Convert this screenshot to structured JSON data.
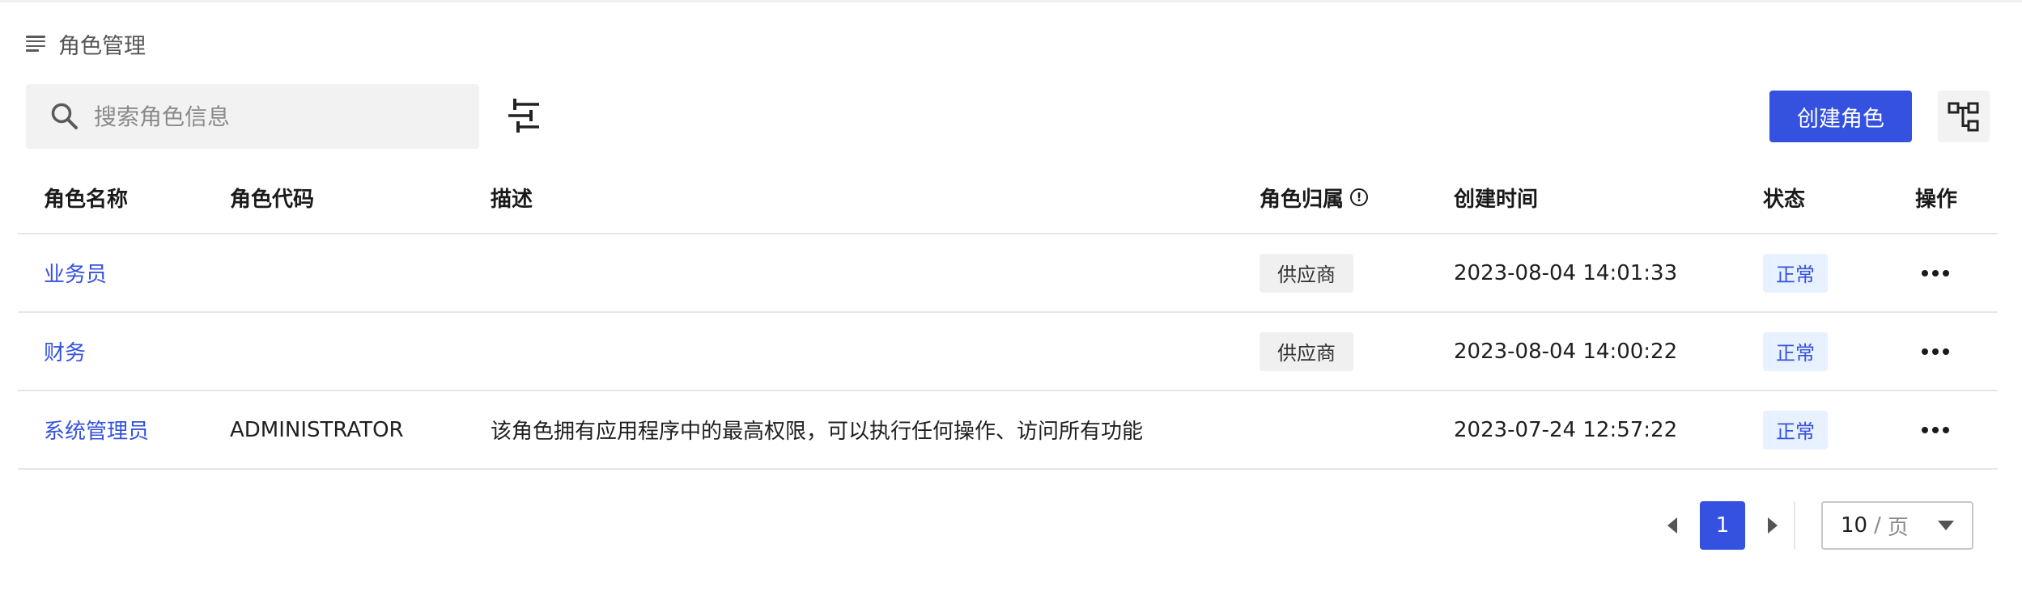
{
  "breadcrumb": {
    "title": "角色管理",
    "icon": "menu-icon"
  },
  "toolbar": {
    "search_placeholder": "搜索角色信息",
    "search_value": "",
    "create_label": "创建角色",
    "filter_icon": "sliders-icon",
    "tree_icon": "tree-structure-icon"
  },
  "table": {
    "headers": {
      "name": "角色名称",
      "code": "角色代码",
      "desc": "描述",
      "owner": "角色归属",
      "time": "创建时间",
      "status": "状态",
      "op": "操作"
    },
    "rows": [
      {
        "name": "业务员",
        "code": "",
        "desc": "",
        "owner": "供应商",
        "time": "2023-08-04 14:01:33",
        "status": "正常"
      },
      {
        "name": "财务",
        "code": "",
        "desc": "",
        "owner": "供应商",
        "time": "2023-08-04 14:00:22",
        "status": "正常"
      },
      {
        "name": "系统管理员",
        "code": "ADMINISTRATOR",
        "desc": "该角色拥有应用程序中的最高权限，可以执行任何操作、访问所有功能",
        "owner": "",
        "time": "2023-07-24 12:57:22",
        "status": "正常"
      }
    ]
  },
  "pagination": {
    "current_page": "1",
    "page_size": "10",
    "separator": "/",
    "page_unit": "页"
  },
  "colors": {
    "accent": "#3451e0",
    "status_bg": "#e8f1ff",
    "tag_bg": "#f0f0f0"
  }
}
